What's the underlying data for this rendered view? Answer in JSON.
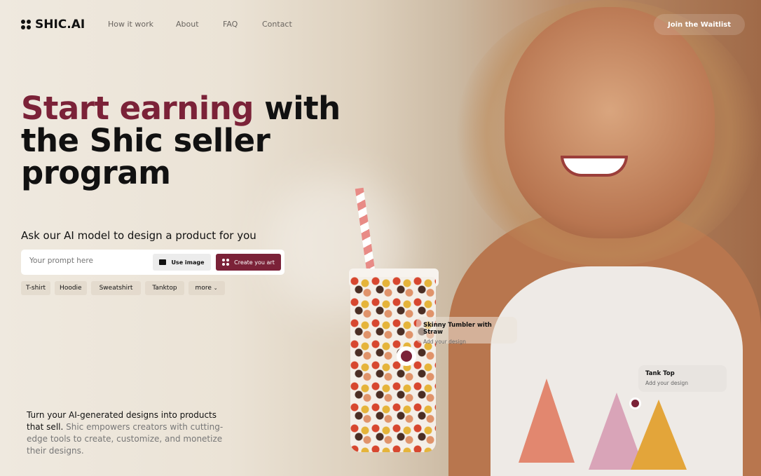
{
  "brand": {
    "name": "SHIC.AI",
    "accent": "#7b2238"
  },
  "nav": {
    "links": [
      "How it work",
      "About",
      "FAQ",
      "Contact"
    ],
    "cta": "Join the Waitlist"
  },
  "hero": {
    "title_accent": "Start earning",
    "title_rest": " with the Shic seller program"
  },
  "prompt": {
    "heading": "Ask our AI model to design a product for you",
    "placeholder": "Your prompt here",
    "use_image": "Use image",
    "create": "Create you art"
  },
  "chips": [
    "T-shirt",
    "Hoodie",
    "Sweatshirt",
    "Tanktop",
    "more"
  ],
  "description": {
    "bold": "Turn your AI-generated designs into products that sell.",
    "rest": " Shic empowers creators with cutting-edge tools to create, customize, and monetize their designs."
  },
  "hotspots": [
    {
      "title": "Skinny Tumbler with Straw",
      "subtitle": "Add your design"
    },
    {
      "title": "Tank Top",
      "subtitle": "Add your design"
    }
  ]
}
